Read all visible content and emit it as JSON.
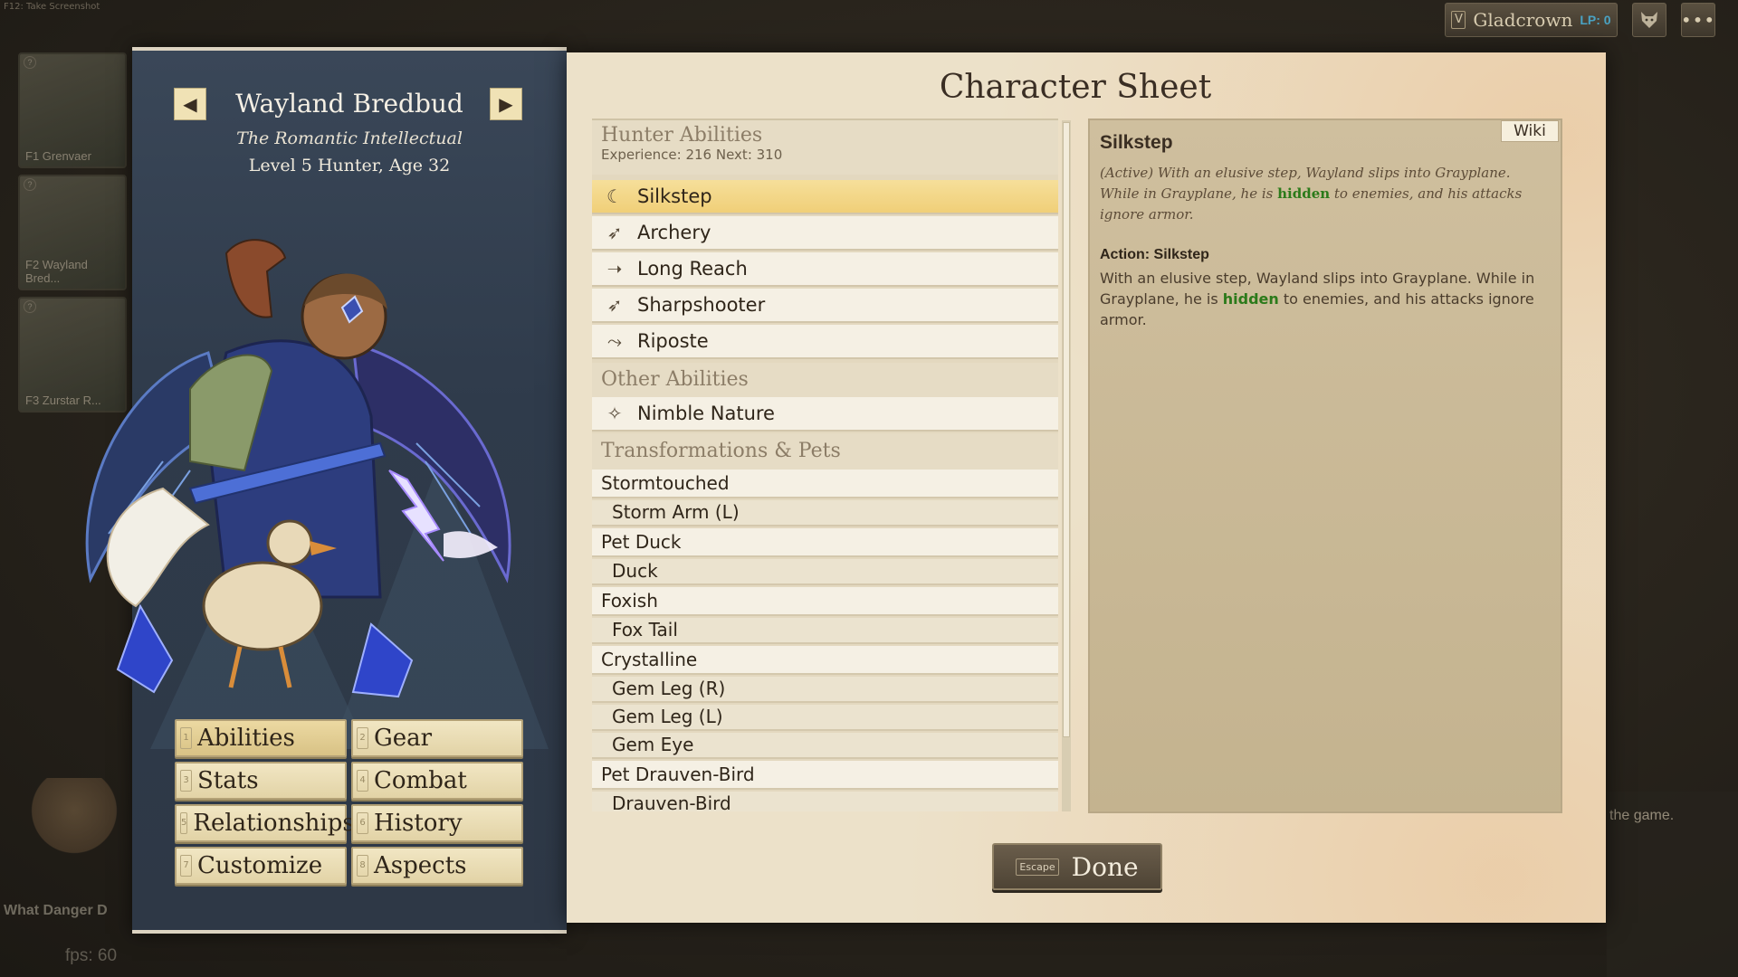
{
  "top": {
    "hint": "F12: Take Screenshot",
    "gladcrown_key": "V",
    "gladcrown_label": "Gladcrown",
    "lp_label": "LP: 0",
    "more_label": "•••"
  },
  "party": [
    {
      "label": "F1 Grenvaer",
      "num": "?"
    },
    {
      "label": "F2 Wayland Bred...",
      "num": "?"
    },
    {
      "label": "F3 Zurstar R...",
      "num": "?"
    }
  ],
  "background": {
    "bottom_left_text": "What Danger D",
    "fps": "fps: 60",
    "game_text": "the game."
  },
  "character": {
    "name": "Wayland Bredbud",
    "title": "The Romantic Intellectual",
    "level": "Level 5 Hunter, Age 32",
    "prev_icon": "◀",
    "next_icon": "▶"
  },
  "menu": [
    {
      "key": "1",
      "label": "Abilities",
      "active": true
    },
    {
      "key": "2",
      "label": "Gear"
    },
    {
      "key": "3",
      "label": "Stats"
    },
    {
      "key": "4",
      "label": "Combat"
    },
    {
      "key": "5",
      "label": "Relationships"
    },
    {
      "key": "6",
      "label": "History"
    },
    {
      "key": "7",
      "label": "Customize"
    },
    {
      "key": "8",
      "label": "Aspects"
    }
  ],
  "sheet": {
    "title": "Character Sheet",
    "hunter_header": "Hunter Abilities",
    "experience": "Experience: 216   Next: 310",
    "hunter_abilities": [
      {
        "label": "Silkstep",
        "icon": "☾",
        "selected": true
      },
      {
        "label": "Archery",
        "icon": "➶"
      },
      {
        "label": "Long Reach",
        "icon": "➝"
      },
      {
        "label": "Sharpshooter",
        "icon": "➶"
      },
      {
        "label": "Riposte",
        "icon": "⤳"
      }
    ],
    "other_header": "Other Abilities",
    "other_abilities": [
      {
        "label": "Nimble Nature",
        "icon": "✧"
      }
    ],
    "transform_header": "Transformations & Pets",
    "transformations": [
      {
        "label": "Stormtouched",
        "child": false
      },
      {
        "label": "Storm Arm (L)",
        "child": true
      },
      {
        "label": "Pet Duck",
        "child": false
      },
      {
        "label": "Duck",
        "child": true
      },
      {
        "label": "Foxish",
        "child": false
      },
      {
        "label": "Fox Tail",
        "child": true
      },
      {
        "label": "Crystalline",
        "child": false
      },
      {
        "label": "Gem Leg (R)",
        "child": true
      },
      {
        "label": "Gem Leg (L)",
        "child": true
      },
      {
        "label": "Gem Eye",
        "child": true
      },
      {
        "label": "Pet Drauven-Bird",
        "child": false
      },
      {
        "label": "Drauven-Bird",
        "child": true
      }
    ]
  },
  "detail": {
    "wiki": "Wiki",
    "title": "Silkstep",
    "desc_pre": "(Active) With an elusive step, Wayland slips into Grayplane. While in Grayplane, he is ",
    "desc_hl": "hidden",
    "desc_post": " to enemies, and his attacks ignore armor.",
    "action_title": "Action: Silkstep",
    "action_pre": "With an elusive step, Wayland slips into Grayplane. While in Grayplane, he is ",
    "action_hl": "hidden",
    "action_post": " to enemies, and his attacks ignore armor."
  },
  "done": {
    "key": "Escape",
    "label": "Done"
  }
}
